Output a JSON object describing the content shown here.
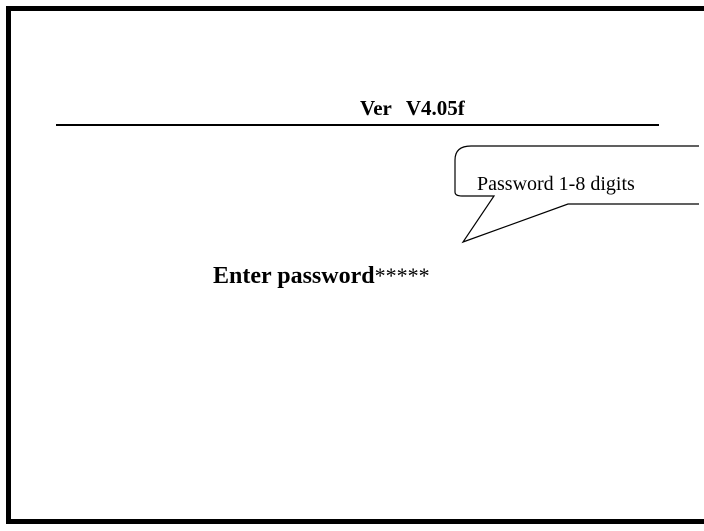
{
  "screen": {
    "version_label": "Ver",
    "version_value": "V4.05f",
    "callout_text": "Password 1-8 digits",
    "prompt_label": "Enter password",
    "password_mask": "*****"
  }
}
